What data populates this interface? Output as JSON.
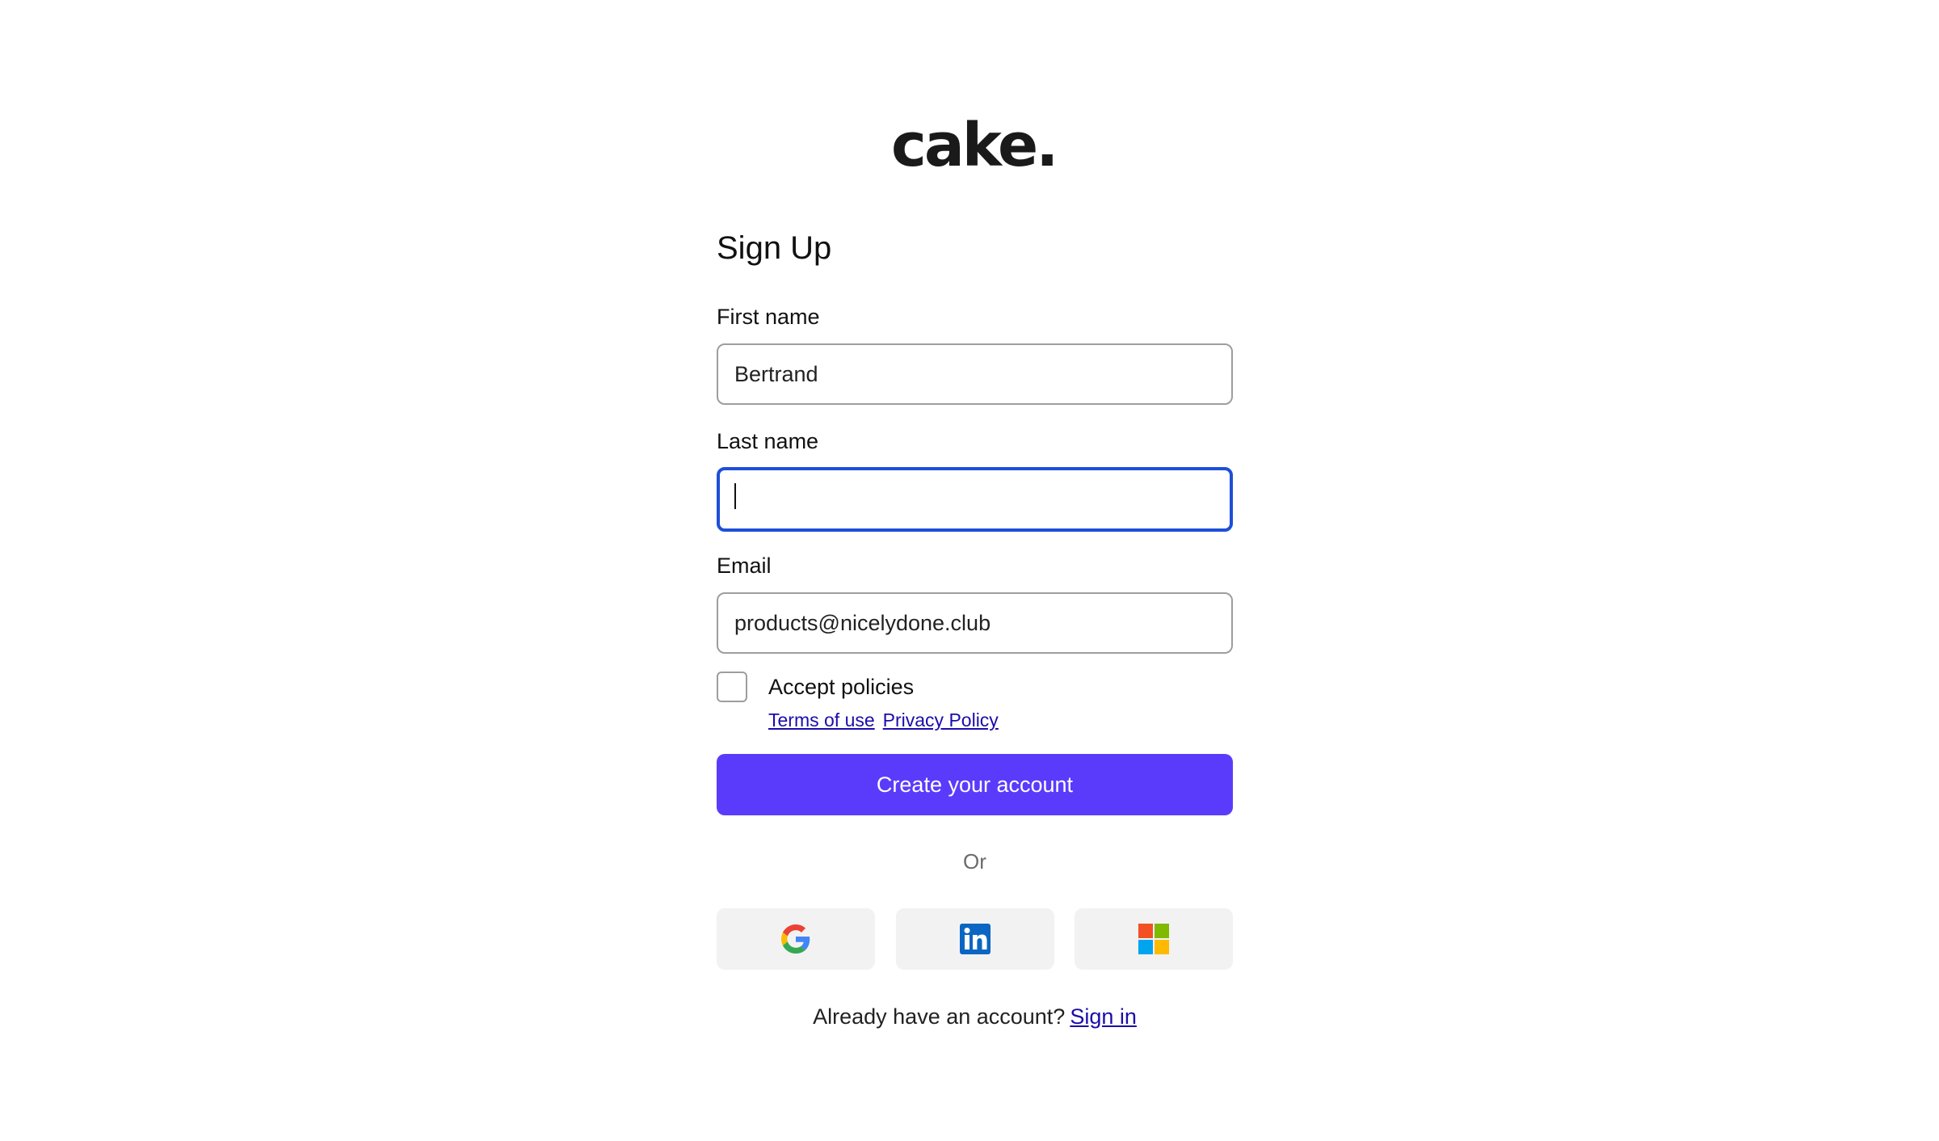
{
  "logo_text": "cake.",
  "heading": "Sign Up",
  "first_name": {
    "label": "First name",
    "value": "Bertrand"
  },
  "last_name": {
    "label": "Last name",
    "value": ""
  },
  "email": {
    "label": "Email",
    "value": "products@nicelydone.club"
  },
  "policies": {
    "label": "Accept policies",
    "checked": false,
    "terms_link": "Terms of use",
    "privacy_link": "Privacy Policy"
  },
  "create_button": "Create your account",
  "divider_text": "Or",
  "social_providers": [
    "google-icon",
    "linkedin-icon",
    "microsoft-icon"
  ],
  "signin": {
    "prompt": "Already have an account?",
    "link": "Sign in"
  },
  "colors": {
    "primary": "#5b3bfb",
    "focus_border": "#1d4fd8",
    "link": "#1a0dab",
    "social_bg": "#f2f2f2"
  }
}
